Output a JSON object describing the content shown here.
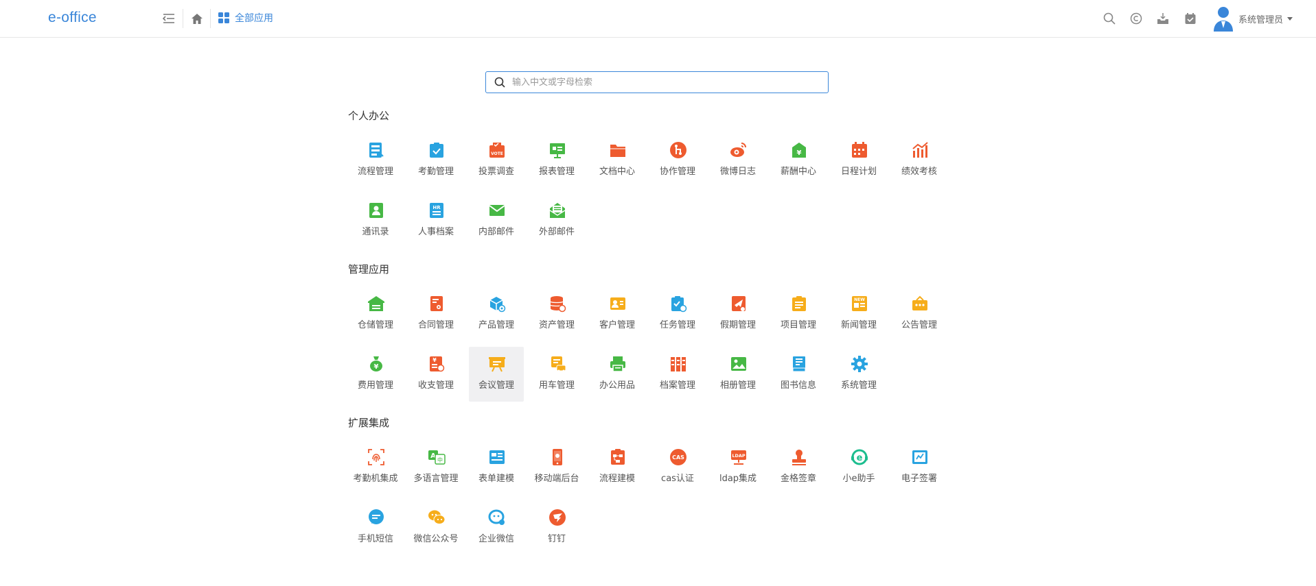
{
  "header": {
    "logo": "e-office",
    "breadcrumb": "全部应用",
    "user_name": "系统管理员",
    "accent": "#3a86d9"
  },
  "search": {
    "placeholder": "输入中文或字母检索"
  },
  "sections": [
    {
      "title": "个人办公",
      "apps": [
        {
          "label": "流程管理",
          "icon": "flowchart-icon",
          "color": "#29a3e0"
        },
        {
          "label": "考勤管理",
          "icon": "clipboard-check-icon",
          "color": "#29a3e0"
        },
        {
          "label": "投票调查",
          "icon": "vote-icon",
          "color": "#ee5b2f"
        },
        {
          "label": "报表管理",
          "icon": "report-board-icon",
          "color": "#47b845"
        },
        {
          "label": "文档中心",
          "icon": "folder-icon",
          "color": "#ee5b2f"
        },
        {
          "label": "协作管理",
          "icon": "collaboration-icon",
          "color": "#ee5b2f"
        },
        {
          "label": "微博日志",
          "icon": "weibo-icon",
          "color": "#ee5b2f"
        },
        {
          "label": "薪酬中心",
          "icon": "salary-icon",
          "color": "#47b845"
        },
        {
          "label": "日程计划",
          "icon": "calendar-icon",
          "color": "#ee5b2f"
        },
        {
          "label": "绩效考核",
          "icon": "performance-chart-icon",
          "color": "#ee5b2f"
        },
        {
          "label": "通讯录",
          "icon": "contacts-icon",
          "color": "#47b845"
        },
        {
          "label": "人事档案",
          "icon": "hr-file-icon",
          "color": "#29a3e0"
        },
        {
          "label": "内部邮件",
          "icon": "mail-icon",
          "color": "#47b845"
        },
        {
          "label": "外部邮件",
          "icon": "open-mail-icon",
          "color": "#47b845"
        }
      ]
    },
    {
      "title": "管理应用",
      "apps": [
        {
          "label": "仓储管理",
          "icon": "warehouse-icon",
          "color": "#47b845"
        },
        {
          "label": "合同管理",
          "icon": "contract-icon",
          "color": "#ee5b2f"
        },
        {
          "label": "产品管理",
          "icon": "product-box-icon",
          "color": "#29a3e0"
        },
        {
          "label": "资产管理",
          "icon": "asset-database-icon",
          "color": "#ee5b2f"
        },
        {
          "label": "客户管理",
          "icon": "customer-card-icon",
          "color": "#f6ad1b"
        },
        {
          "label": "任务管理",
          "icon": "task-clipboard-icon",
          "color": "#29a3e0"
        },
        {
          "label": "假期管理",
          "icon": "holiday-plane-icon",
          "color": "#ee5b2f"
        },
        {
          "label": "项目管理",
          "icon": "project-list-icon",
          "color": "#f6ad1b"
        },
        {
          "label": "新闻管理",
          "icon": "news-icon",
          "color": "#f6ad1b"
        },
        {
          "label": "公告管理",
          "icon": "notice-board-icon",
          "color": "#f6ad1b"
        },
        {
          "label": "费用管理",
          "icon": "money-bag-icon",
          "color": "#47b845"
        },
        {
          "label": "收支管理",
          "icon": "income-expense-icon",
          "color": "#ee5b2f"
        },
        {
          "label": "会议管理",
          "icon": "meeting-board-icon",
          "color": "#f6ad1b"
        },
        {
          "label": "用车管理",
          "icon": "car-icon",
          "color": "#f6ad1b"
        },
        {
          "label": "办公用品",
          "icon": "printer-icon",
          "color": "#47b845"
        },
        {
          "label": "档案管理",
          "icon": "archive-icon",
          "color": "#ee5b2f"
        },
        {
          "label": "相册管理",
          "icon": "photo-album-icon",
          "color": "#47b845"
        },
        {
          "label": "图书信息",
          "icon": "book-icon",
          "color": "#29a3e0"
        },
        {
          "label": "系统管理",
          "icon": "gear-icon",
          "color": "#29a3e0"
        }
      ]
    },
    {
      "title": "扩展集成",
      "apps": [
        {
          "label": "考勤机集成",
          "icon": "fingerprint-icon",
          "color": "#ee5b2f"
        },
        {
          "label": "多语言管理",
          "icon": "language-icon",
          "color": "#47b845"
        },
        {
          "label": "表单建模",
          "icon": "form-model-icon",
          "color": "#29a3e0"
        },
        {
          "label": "移动端后台",
          "icon": "mobile-icon",
          "color": "#ee5b2f"
        },
        {
          "label": "流程建模",
          "icon": "flow-model-icon",
          "color": "#ee5b2f"
        },
        {
          "label": "cas认证",
          "icon": "cas-icon",
          "color": "#ee5b2f"
        },
        {
          "label": "ldap集成",
          "icon": "ldap-icon",
          "color": "#ee5b2f"
        },
        {
          "label": "金格签章",
          "icon": "stamp-icon",
          "color": "#ee5b2f"
        },
        {
          "label": "小e助手",
          "icon": "assistant-icon",
          "color": "#1bbd8e"
        },
        {
          "label": "电子签署",
          "icon": "e-sign-icon",
          "color": "#29a3e0"
        },
        {
          "label": "手机短信",
          "icon": "sms-icon",
          "color": "#29a3e0"
        },
        {
          "label": "微信公众号",
          "icon": "wechat-icon",
          "color": "#f6ad1b"
        },
        {
          "label": "企业微信",
          "icon": "work-wechat-icon",
          "color": "#29a3e0"
        },
        {
          "label": "钉钉",
          "icon": "dingtalk-icon",
          "color": "#ee5b2f"
        }
      ]
    }
  ],
  "hovered_app": "会议管理"
}
